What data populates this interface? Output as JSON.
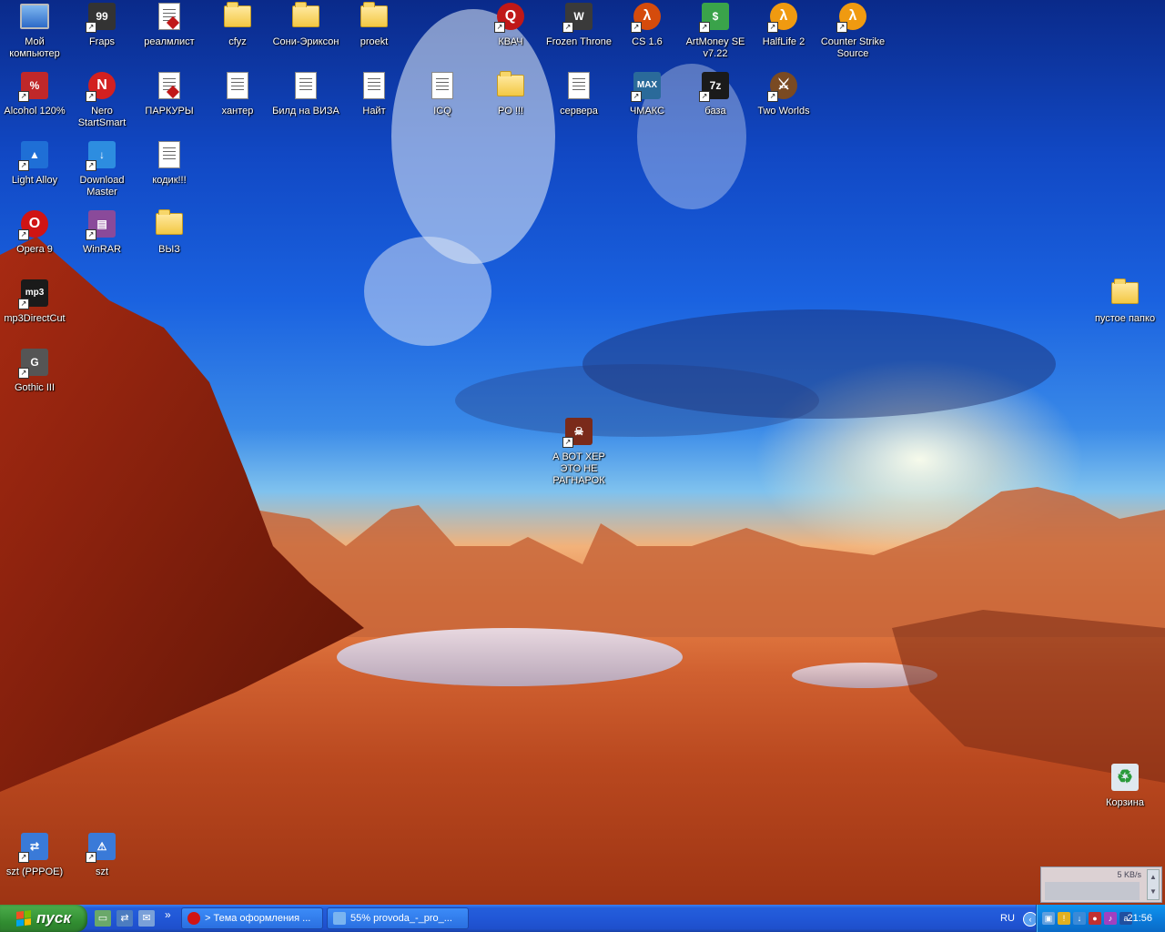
{
  "desktop": {
    "icons": [
      {
        "label": "Мой компьютер",
        "icon": "my-computer-icon",
        "kind": "monitor",
        "color": "#4f8fe8"
      },
      {
        "label": "Fraps",
        "icon": "fraps-icon",
        "kind": "square",
        "color": "#333333",
        "glyph": "99"
      },
      {
        "label": "реалмлист",
        "icon": "document-icon",
        "kind": "docred",
        "color": "#ffffff"
      },
      {
        "label": "cfyz",
        "icon": "folder-icon",
        "kind": "folder",
        "color": "#f3c844"
      },
      {
        "label": "Сони-Эриксон",
        "icon": "folder-icon",
        "kind": "folder",
        "color": "#f3c844"
      },
      {
        "label": "proekt",
        "icon": "folder-icon",
        "kind": "folder",
        "color": "#f3c844"
      },
      {
        "label": "КВАЧ",
        "icon": "quake-icon",
        "kind": "circle",
        "color": "#c01818",
        "glyph": "Q"
      },
      {
        "label": "Frozen Throne",
        "icon": "warcraft-icon",
        "kind": "square",
        "color": "#3a3a3a",
        "glyph": "W"
      },
      {
        "label": "CS 1.6",
        "icon": "half-life-icon",
        "kind": "circle",
        "color": "#d54b0c",
        "glyph": "λ"
      },
      {
        "label": "ArtMoney SE v7.22",
        "icon": "artmoney-icon",
        "kind": "square",
        "color": "#3aa34a",
        "glyph": "$"
      },
      {
        "label": "HalfLife 2",
        "icon": "half-life-2-icon",
        "kind": "circle",
        "color": "#f09a10",
        "glyph": "λ"
      },
      {
        "label": "Counter Strike Source",
        "icon": "half-life-2-icon",
        "kind": "circle",
        "color": "#f09a10",
        "glyph": "λ"
      },
      {
        "label": "Alcohol 120%",
        "icon": "alcohol-icon",
        "kind": "square",
        "color": "#c0282a",
        "glyph": "%"
      },
      {
        "label": "Nero StartSmart",
        "icon": "nero-icon",
        "kind": "circle",
        "color": "#d22020",
        "glyph": "N"
      },
      {
        "label": "ПАРКУРЫ",
        "icon": "document-icon",
        "kind": "docred",
        "color": "#ffffff"
      },
      {
        "label": "хантер",
        "icon": "text-file-icon",
        "kind": "doc",
        "color": "#ffffff"
      },
      {
        "label": "Билд на ВИЗА",
        "icon": "text-file-icon",
        "kind": "doc",
        "color": "#ffffff"
      },
      {
        "label": "Найт",
        "icon": "text-file-icon",
        "kind": "doc",
        "color": "#ffffff"
      },
      {
        "label": "ICQ",
        "icon": "text-file-icon",
        "kind": "doc",
        "color": "#ffffff"
      },
      {
        "label": "PO !!!",
        "icon": "folder-icon",
        "kind": "folder",
        "color": "#f3c844"
      },
      {
        "label": "сервера",
        "icon": "text-file-icon",
        "kind": "doc",
        "color": "#ffffff"
      },
      {
        "label": "ЧМАКС",
        "icon": "cheatmax-icon",
        "kind": "square",
        "color": "#2a6a9a",
        "glyph": "MAX"
      },
      {
        "label": "база",
        "icon": "database-icon",
        "kind": "square",
        "color": "#1a1a1a",
        "glyph": "7z"
      },
      {
        "label": "Two Worlds",
        "icon": "two-worlds-icon",
        "kind": "circle",
        "color": "#7a4a22",
        "glyph": "⚔"
      },
      {
        "label": "Light Alloy",
        "icon": "light-alloy-icon",
        "kind": "square",
        "color": "#1f6fd6",
        "glyph": "▲"
      },
      {
        "label": "Download Master",
        "icon": "download-master-icon",
        "kind": "square",
        "color": "#2d8de0",
        "glyph": "↓"
      },
      {
        "label": "кодик!!!",
        "icon": "text-file-icon",
        "kind": "doc",
        "color": "#ffffff"
      },
      {
        "label": "Opera 9",
        "icon": "opera-icon",
        "kind": "circle",
        "color": "#d01414",
        "glyph": "O"
      },
      {
        "label": "WinRAR",
        "icon": "winrar-icon",
        "kind": "square",
        "color": "#8a4a9a",
        "glyph": "▤"
      },
      {
        "label": "ВЫЗ",
        "icon": "folder-icon",
        "kind": "folder",
        "color": "#f3c844"
      },
      {
        "label": "mp3DirectCut",
        "icon": "mp3directcut-icon",
        "kind": "square",
        "color": "#1a1a1a",
        "glyph": "mp3"
      },
      {
        "label": "Gothic III",
        "icon": "gothic-icon",
        "kind": "square",
        "color": "#555555",
        "glyph": "G"
      },
      {
        "label": "А ВОТ ХЕР ЭТО НЕ РАГНАРОК",
        "icon": "game-shortcut-icon",
        "kind": "square",
        "color": "#7a2a1a",
        "glyph": "☠"
      },
      {
        "label": "пустое папко",
        "icon": "folder-icon",
        "kind": "folder",
        "color": "#f3c844"
      },
      {
        "label": "Корзина",
        "icon": "recycle-bin-icon",
        "kind": "square",
        "color": "#dfe8ef",
        "glyph": "♻"
      },
      {
        "label": "szt (PPPOE)",
        "icon": "network-connection-icon",
        "kind": "square",
        "color": "#3a7ad8",
        "glyph": "⇄"
      },
      {
        "label": "szt",
        "icon": "network-warning-icon",
        "kind": "square",
        "color": "#3a7ad8",
        "glyph": "⚠"
      }
    ]
  },
  "speed_widget": {
    "rate": "5 KB/s"
  },
  "taskbar": {
    "start_label": "пуск",
    "quick_launch": [
      "show-desktop-icon",
      "network-icon",
      "messenger-icon"
    ],
    "tasks": [
      {
        "label": "> Тема оформления ...",
        "icon": "opera-icon",
        "color": "#d01414"
      },
      {
        "label": "55% provoda_-_pro_...",
        "icon": "download-master-icon",
        "color": "#7ab4f0"
      }
    ],
    "language": "RU",
    "clock": "21:56"
  },
  "colors": {
    "taskbar": "#245edb",
    "start": "#3c9a3c",
    "tray": "#0b7ddc"
  }
}
